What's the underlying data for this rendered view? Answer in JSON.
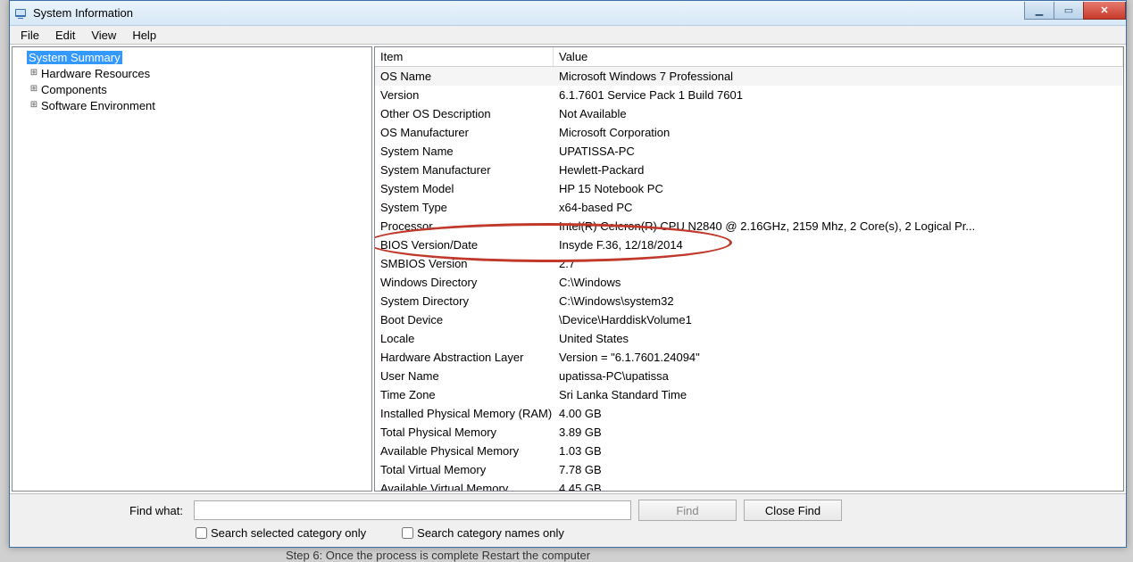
{
  "window": {
    "title": "System Information"
  },
  "menu": {
    "file": "File",
    "edit": "Edit",
    "view": "View",
    "help": "Help"
  },
  "tree": {
    "root": "System Summary",
    "children": [
      {
        "label": "Hardware Resources"
      },
      {
        "label": "Components"
      },
      {
        "label": "Software Environment"
      }
    ]
  },
  "details": {
    "header_item": "Item",
    "header_value": "Value",
    "rows": [
      {
        "item": "OS Name",
        "value": "Microsoft Windows 7 Professional"
      },
      {
        "item": "Version",
        "value": "6.1.7601 Service Pack 1 Build 7601"
      },
      {
        "item": "Other OS Description",
        "value": "Not Available"
      },
      {
        "item": "OS Manufacturer",
        "value": "Microsoft Corporation"
      },
      {
        "item": "System Name",
        "value": "UPATISSA-PC"
      },
      {
        "item": "System Manufacturer",
        "value": "Hewlett-Packard"
      },
      {
        "item": "System Model",
        "value": "HP 15 Notebook PC"
      },
      {
        "item": "System Type",
        "value": "x64-based PC"
      },
      {
        "item": "Processor",
        "value": "Intel(R) Celeron(R) CPU  N2840  @ 2.16GHz, 2159 Mhz, 2 Core(s), 2 Logical Pr..."
      },
      {
        "item": "BIOS Version/Date",
        "value": "Insyde F.36, 12/18/2014"
      },
      {
        "item": "SMBIOS Version",
        "value": "2.7"
      },
      {
        "item": "Windows Directory",
        "value": "C:\\Windows"
      },
      {
        "item": "System Directory",
        "value": "C:\\Windows\\system32"
      },
      {
        "item": "Boot Device",
        "value": "\\Device\\HarddiskVolume1"
      },
      {
        "item": "Locale",
        "value": "United States"
      },
      {
        "item": "Hardware Abstraction Layer",
        "value": "Version = \"6.1.7601.24094\""
      },
      {
        "item": "User Name",
        "value": "upatissa-PC\\upatissa"
      },
      {
        "item": "Time Zone",
        "value": "Sri Lanka Standard Time"
      },
      {
        "item": "Installed Physical Memory (RAM)",
        "value": "4.00 GB"
      },
      {
        "item": "Total Physical Memory",
        "value": "3.89 GB"
      },
      {
        "item": "Available Physical Memory",
        "value": "1.03 GB"
      },
      {
        "item": "Total Virtual Memory",
        "value": "7.78 GB"
      },
      {
        "item": "Available Virtual Memory",
        "value": "4.45 GB"
      }
    ]
  },
  "find": {
    "label": "Find what:",
    "value": "",
    "find_btn": "Find",
    "close_btn": "Close Find",
    "chk_selected": "Search selected category only",
    "chk_names": "Search category names only"
  },
  "footer_hint": "Step 6: Once the process is complete  Restart the computer",
  "annotation": {
    "highlight_row_index": 9
  }
}
